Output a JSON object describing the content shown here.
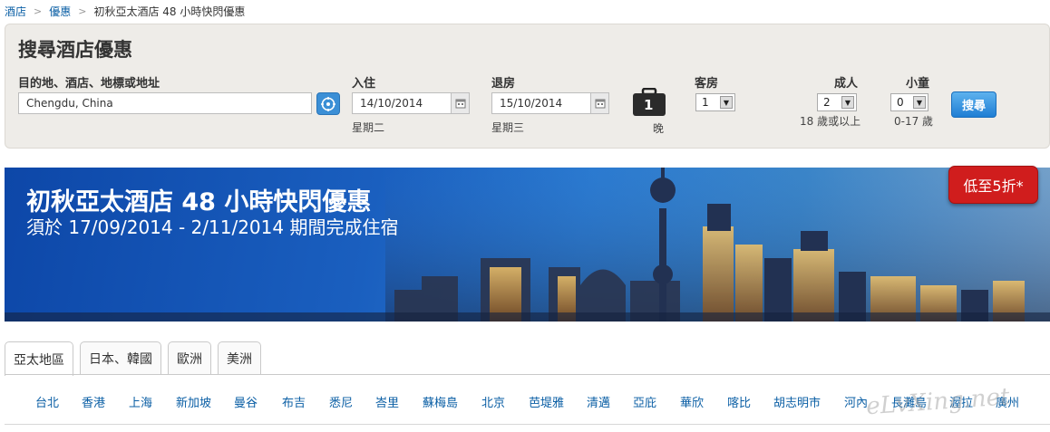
{
  "breadcrumb": {
    "items": [
      "酒店",
      "優惠"
    ],
    "current": "初秋亞太酒店 48 小時快閃優惠"
  },
  "search": {
    "title": "搜尋酒店優惠",
    "destination_label": "目的地、酒店、地標或地址",
    "destination_value": "Chengdu, China",
    "checkin_label": "入住",
    "checkin_value": "14/10/2014",
    "checkin_day": "星期二",
    "checkout_label": "退房",
    "checkout_value": "15/10/2014",
    "checkout_day": "星期三",
    "nights_value": "1",
    "nights_label": "晚",
    "rooms_label": "客房",
    "rooms_value": "1",
    "adults_label": "成人",
    "adults_value": "2",
    "adults_note": "18 歲或以上",
    "children_label": "小童",
    "children_value": "0",
    "children_note": "0-17 歲",
    "search_button": "搜尋"
  },
  "banner": {
    "title": "初秋亞太酒店 48 小時快閃優惠",
    "subtitle": "須於 17/09/2014 - 2/11/2014 期間完成住宿",
    "badge": "低至5折*"
  },
  "tabs": [
    "亞太地區",
    "日本、韓國",
    "歐洲",
    "美洲"
  ],
  "cities": [
    "台北",
    "香港",
    "上海",
    "新加坡",
    "曼谷",
    "布吉",
    "悉尼",
    "峇里",
    "蘇梅島",
    "北京",
    "芭堤雅",
    "清邁",
    "亞庇",
    "華欣",
    "喀比",
    "胡志明市",
    "河內",
    "長灘島",
    "渥拉",
    "廣州"
  ],
  "watermark": "eLvXing.net",
  "colors": {
    "link": "#0b5fa5",
    "badge": "#d01d1d",
    "button": "#1f7ed4",
    "banner": "#1a5fbf"
  }
}
